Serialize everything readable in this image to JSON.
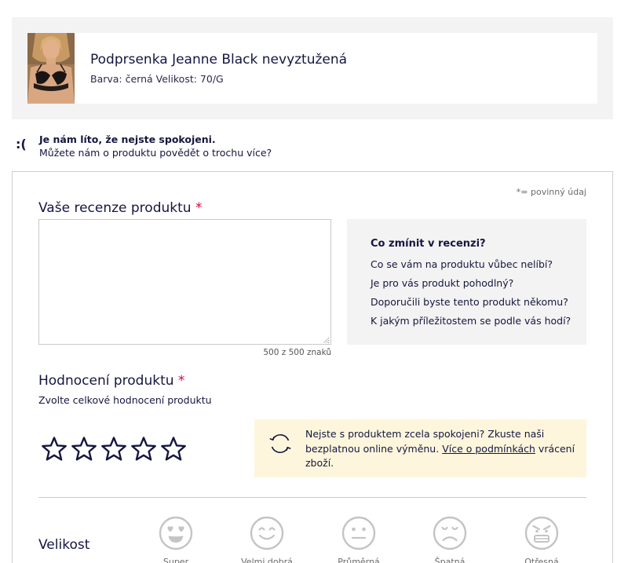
{
  "product": {
    "name": "Podprsenka Jeanne Black nevyztužená",
    "meta": "Barva: černá Velikost: 70/G"
  },
  "feedback": {
    "face": ":(",
    "title": "Je nám líto, že nejste spokojeni.",
    "subtitle": "Můžete nám o produktu povědět o trochu více?"
  },
  "form": {
    "required_note": "*= povinný údaj",
    "required_mark": "*",
    "review": {
      "label": "Vaše recenze produktu",
      "value": "",
      "counter": "500 z 500 znaků"
    },
    "tips": {
      "title": "Co zmínit v recenzi?",
      "items": [
        "Co se vám na produktu vůbec nelíbí?",
        "Je pro vás produkt pohodlný?",
        "Doporučili byste tento produkt někomu?",
        "K jakým příležitostem se podle vás hodí?"
      ]
    },
    "rating": {
      "label": "Hodnocení produktu",
      "hint": "Zvolte celkové hodnocení produktu",
      "value": 0,
      "max": 5
    },
    "exchange": {
      "text_before": "Nejste s produktem zcela spokojeni? Zkuste naši bezplatnou online výměnu.",
      "link": "Více o podmínkách",
      "text_after": "vrácení zboží."
    },
    "size": {
      "label": "Velikost",
      "options": [
        "Super",
        "Velmi dobrá",
        "Průměrná",
        "Špatná",
        "Otřesná"
      ]
    }
  },
  "colors": {
    "text": "#161640",
    "required": "#d6003c",
    "panel": "#f3f3f3",
    "notice": "#fdf6dc",
    "icon_grey": "#c4c4c4"
  }
}
